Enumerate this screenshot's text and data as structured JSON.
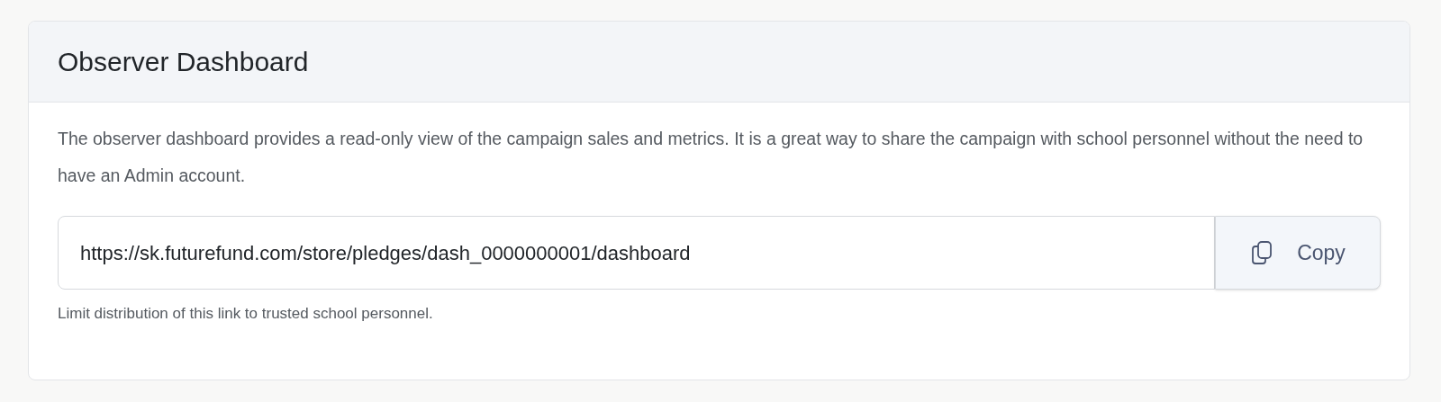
{
  "card": {
    "title": "Observer Dashboard",
    "description": "The observer dashboard provides a read-only view of the campaign sales and metrics. It is a great way to share the campaign with school personnel without the need to have an Admin account.",
    "link_field": {
      "value": "https://sk.futurefund.com/store/pledges/dash_0000000001/dashboard"
    },
    "copy_button": {
      "label": "Copy"
    },
    "help_text": "Limit distribution of this link to trusted school personnel."
  }
}
